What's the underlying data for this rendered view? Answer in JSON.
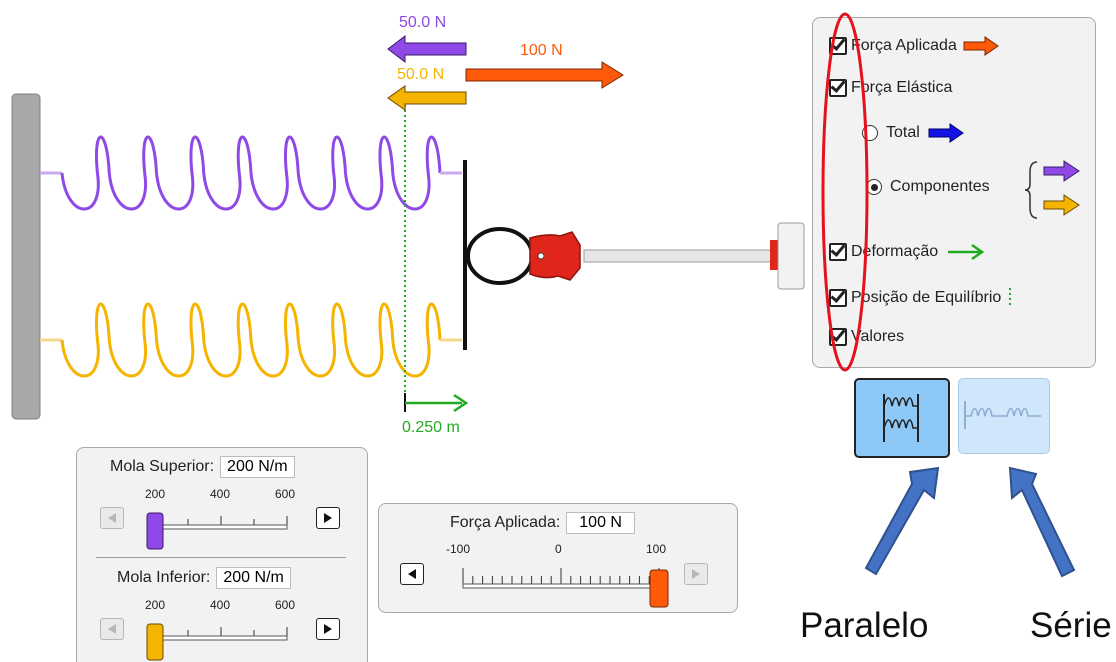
{
  "vectors": {
    "top_spring_force": "50.0 N",
    "bottom_spring_force": "50.0 N",
    "applied_force": "100 N",
    "displacement": "0.250 m"
  },
  "checkbox_panel": {
    "applied_force": "Força Aplicada",
    "spring_force": "Força Elástica",
    "total": "Total",
    "components": "Componentes",
    "displacement": "Deformação",
    "equilibrium": "Posição de Equilíbrio",
    "values": "Valores"
  },
  "spring_panel": {
    "top_label": "Mola Superior:",
    "top_value": "200 N/m",
    "bottom_label": "Mola Inferior:",
    "bottom_value": "200 N/m",
    "ticks": [
      "200",
      "400",
      "600"
    ],
    "top_fraction": 0.0,
    "bottom_fraction": 0.0
  },
  "force_panel": {
    "label": "Força Aplicada:",
    "value": "100 N",
    "ticks": [
      "-100",
      "0",
      "100"
    ],
    "fraction": 1.0
  },
  "modes": {
    "parallel": "Paralelo",
    "series": "Série"
  },
  "colors": {
    "top_spring": "#8f49e6",
    "bottom_spring": "#f5b400",
    "applied": "#ff5a0a",
    "total": "#1414e6",
    "displacement": "#22aa22",
    "highlight": "#e5111b",
    "annotation_arrow": "#4472c4"
  },
  "icons": [
    "checkbox-icon",
    "radio-icon",
    "arrow-left-icon",
    "arrow-right-icon",
    "wall-icon",
    "robot-hand-icon"
  ]
}
